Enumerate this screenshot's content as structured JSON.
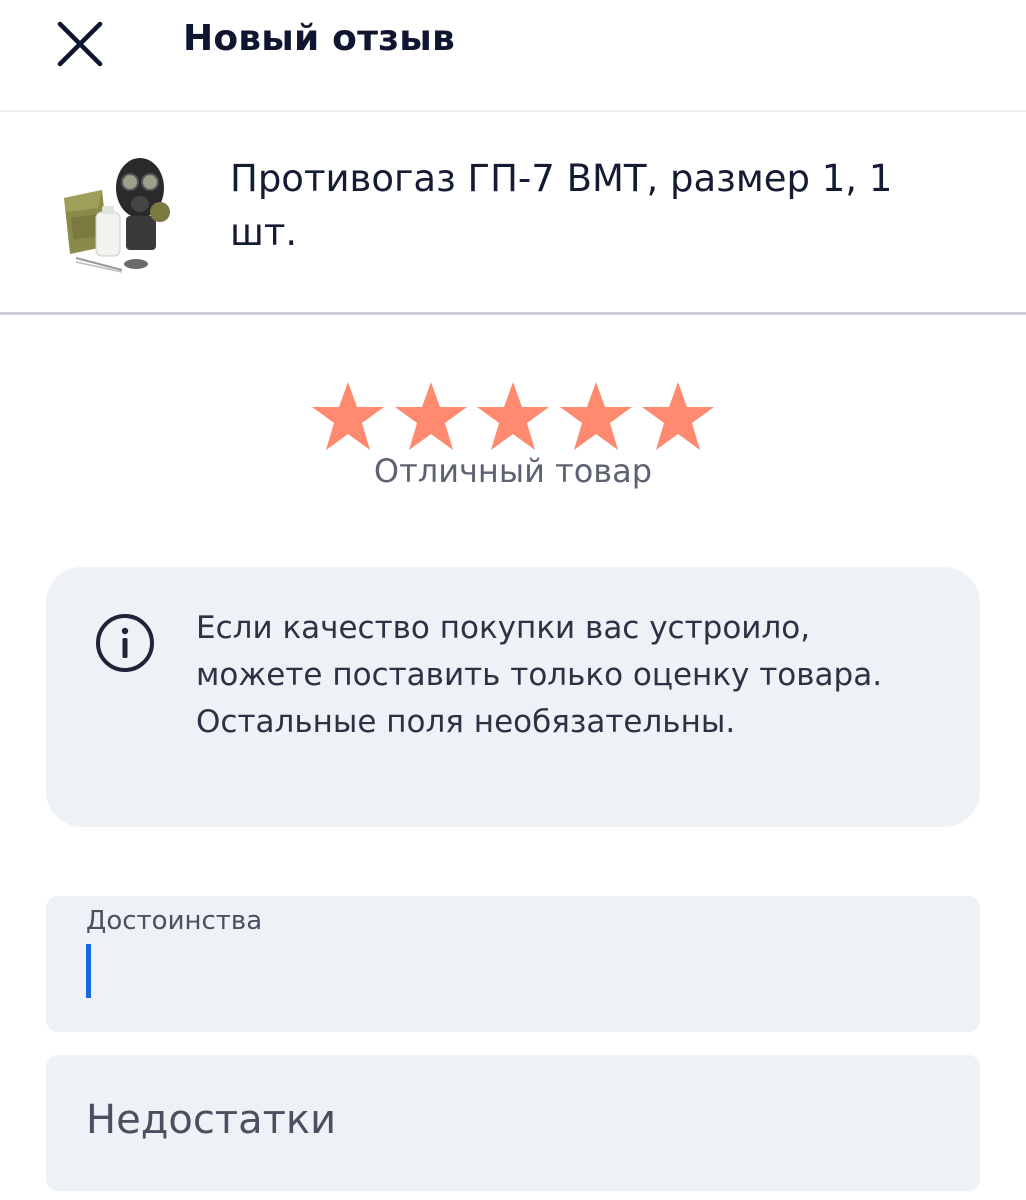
{
  "header": {
    "title": "Новый отзыв",
    "close_icon": "close-icon"
  },
  "product": {
    "name": "Противогаз ГП-7 ВМТ, размер 1, 1 шт.",
    "image_icon": "gas-mask-product-image"
  },
  "rating": {
    "value": 5,
    "max": 5,
    "label": "Отличный товар",
    "star_color": "#ff8a70"
  },
  "info": {
    "icon": "info-icon",
    "text": "Если качество покупки вас устроило, можете поставить только оценку товара. Остальные поля необязательны."
  },
  "form": {
    "pros_label": "Достоинства",
    "pros_value": "",
    "cons_placeholder": "Недостатки"
  },
  "colors": {
    "field_bg": "#eef1f5",
    "caret": "#1769e0",
    "title_text": "#0f1730"
  }
}
